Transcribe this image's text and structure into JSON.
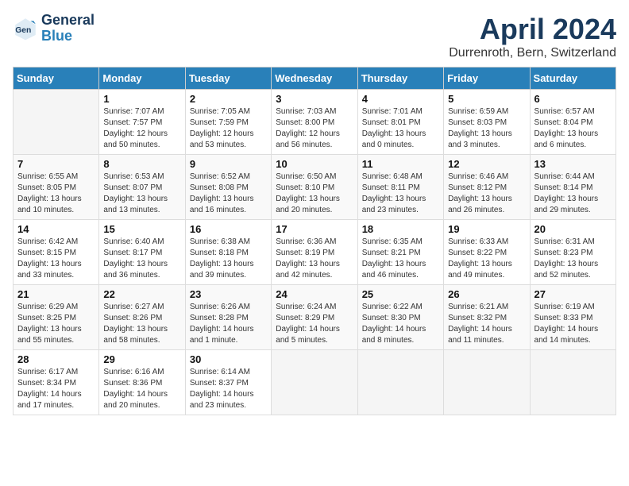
{
  "logo": {
    "line1": "General",
    "line2": "Blue"
  },
  "title": "April 2024",
  "subtitle": "Durrenroth, Bern, Switzerland",
  "weekdays": [
    "Sunday",
    "Monday",
    "Tuesday",
    "Wednesday",
    "Thursday",
    "Friday",
    "Saturday"
  ],
  "weeks": [
    [
      {
        "day": "",
        "info": ""
      },
      {
        "day": "1",
        "info": "Sunrise: 7:07 AM\nSunset: 7:57 PM\nDaylight: 12 hours\nand 50 minutes."
      },
      {
        "day": "2",
        "info": "Sunrise: 7:05 AM\nSunset: 7:59 PM\nDaylight: 12 hours\nand 53 minutes."
      },
      {
        "day": "3",
        "info": "Sunrise: 7:03 AM\nSunset: 8:00 PM\nDaylight: 12 hours\nand 56 minutes."
      },
      {
        "day": "4",
        "info": "Sunrise: 7:01 AM\nSunset: 8:01 PM\nDaylight: 13 hours\nand 0 minutes."
      },
      {
        "day": "5",
        "info": "Sunrise: 6:59 AM\nSunset: 8:03 PM\nDaylight: 13 hours\nand 3 minutes."
      },
      {
        "day": "6",
        "info": "Sunrise: 6:57 AM\nSunset: 8:04 PM\nDaylight: 13 hours\nand 6 minutes."
      }
    ],
    [
      {
        "day": "7",
        "info": "Sunrise: 6:55 AM\nSunset: 8:05 PM\nDaylight: 13 hours\nand 10 minutes."
      },
      {
        "day": "8",
        "info": "Sunrise: 6:53 AM\nSunset: 8:07 PM\nDaylight: 13 hours\nand 13 minutes."
      },
      {
        "day": "9",
        "info": "Sunrise: 6:52 AM\nSunset: 8:08 PM\nDaylight: 13 hours\nand 16 minutes."
      },
      {
        "day": "10",
        "info": "Sunrise: 6:50 AM\nSunset: 8:10 PM\nDaylight: 13 hours\nand 20 minutes."
      },
      {
        "day": "11",
        "info": "Sunrise: 6:48 AM\nSunset: 8:11 PM\nDaylight: 13 hours\nand 23 minutes."
      },
      {
        "day": "12",
        "info": "Sunrise: 6:46 AM\nSunset: 8:12 PM\nDaylight: 13 hours\nand 26 minutes."
      },
      {
        "day": "13",
        "info": "Sunrise: 6:44 AM\nSunset: 8:14 PM\nDaylight: 13 hours\nand 29 minutes."
      }
    ],
    [
      {
        "day": "14",
        "info": "Sunrise: 6:42 AM\nSunset: 8:15 PM\nDaylight: 13 hours\nand 33 minutes."
      },
      {
        "day": "15",
        "info": "Sunrise: 6:40 AM\nSunset: 8:17 PM\nDaylight: 13 hours\nand 36 minutes."
      },
      {
        "day": "16",
        "info": "Sunrise: 6:38 AM\nSunset: 8:18 PM\nDaylight: 13 hours\nand 39 minutes."
      },
      {
        "day": "17",
        "info": "Sunrise: 6:36 AM\nSunset: 8:19 PM\nDaylight: 13 hours\nand 42 minutes."
      },
      {
        "day": "18",
        "info": "Sunrise: 6:35 AM\nSunset: 8:21 PM\nDaylight: 13 hours\nand 46 minutes."
      },
      {
        "day": "19",
        "info": "Sunrise: 6:33 AM\nSunset: 8:22 PM\nDaylight: 13 hours\nand 49 minutes."
      },
      {
        "day": "20",
        "info": "Sunrise: 6:31 AM\nSunset: 8:23 PM\nDaylight: 13 hours\nand 52 minutes."
      }
    ],
    [
      {
        "day": "21",
        "info": "Sunrise: 6:29 AM\nSunset: 8:25 PM\nDaylight: 13 hours\nand 55 minutes."
      },
      {
        "day": "22",
        "info": "Sunrise: 6:27 AM\nSunset: 8:26 PM\nDaylight: 13 hours\nand 58 minutes."
      },
      {
        "day": "23",
        "info": "Sunrise: 6:26 AM\nSunset: 8:28 PM\nDaylight: 14 hours\nand 1 minute."
      },
      {
        "day": "24",
        "info": "Sunrise: 6:24 AM\nSunset: 8:29 PM\nDaylight: 14 hours\nand 5 minutes."
      },
      {
        "day": "25",
        "info": "Sunrise: 6:22 AM\nSunset: 8:30 PM\nDaylight: 14 hours\nand 8 minutes."
      },
      {
        "day": "26",
        "info": "Sunrise: 6:21 AM\nSunset: 8:32 PM\nDaylight: 14 hours\nand 11 minutes."
      },
      {
        "day": "27",
        "info": "Sunrise: 6:19 AM\nSunset: 8:33 PM\nDaylight: 14 hours\nand 14 minutes."
      }
    ],
    [
      {
        "day": "28",
        "info": "Sunrise: 6:17 AM\nSunset: 8:34 PM\nDaylight: 14 hours\nand 17 minutes."
      },
      {
        "day": "29",
        "info": "Sunrise: 6:16 AM\nSunset: 8:36 PM\nDaylight: 14 hours\nand 20 minutes."
      },
      {
        "day": "30",
        "info": "Sunrise: 6:14 AM\nSunset: 8:37 PM\nDaylight: 14 hours\nand 23 minutes."
      },
      {
        "day": "",
        "info": ""
      },
      {
        "day": "",
        "info": ""
      },
      {
        "day": "",
        "info": ""
      },
      {
        "day": "",
        "info": ""
      }
    ]
  ]
}
